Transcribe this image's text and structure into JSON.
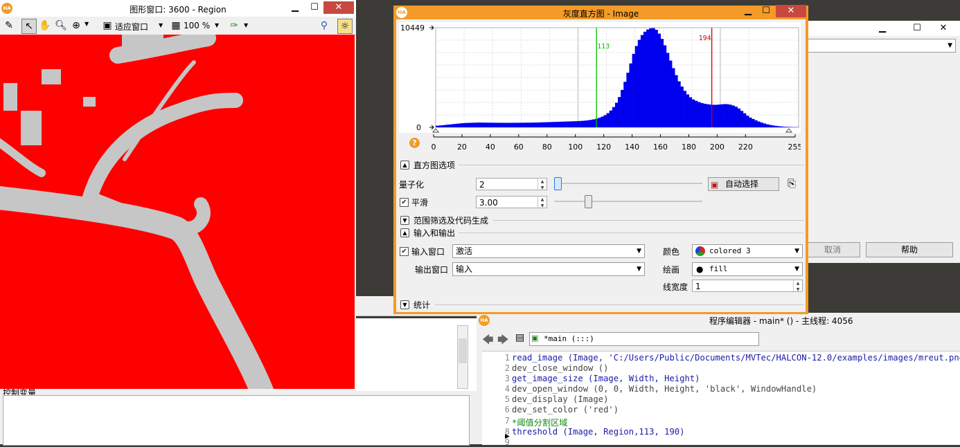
{
  "graphics_window": {
    "title": "图形窗口: 3600 - Region",
    "logo": "HA",
    "zoom_mode": "适应窗口",
    "zoom_percent": "100 %",
    "toolbar_icons": [
      "pencil-icon",
      "pointer-icon",
      "hand-icon",
      "magnifier-icon",
      "zoom-in-icon",
      "fit-window-icon",
      "zoom-percent-icon",
      "color-picker-icon",
      "pixel-info-icon",
      "light-icon"
    ],
    "region_color": "#ff0000",
    "image_color": "#c8c8c8"
  },
  "histogram": {
    "title": "灰度直方图 - Image",
    "logo": "HA",
    "help_icon": "?",
    "y_max_label": "10449",
    "y_min_label": "0",
    "min_threshold": "113",
    "max_threshold": "194",
    "min_color": "#00c000",
    "max_color": "#d00000",
    "bar_color": "#0000ee",
    "options_section": "直方图选项",
    "quantize_label": "量子化",
    "quantize_value": "2",
    "auto_select_label": "自动选择",
    "smooth_label": "平滑",
    "smooth_checked": true,
    "smooth_value": "3.00",
    "range_section": "范围筛选及代码生成",
    "io_section": "输入和输出",
    "input_window_label": "输入窗口",
    "input_window_value": "激活",
    "output_window_label": "输出窗口",
    "output_window_value": "输入",
    "color_label": "颜色",
    "color_value": "colored 3",
    "draw_label": "绘画",
    "draw_value": "fill",
    "line_width_label": "线宽度",
    "line_width_value": "1",
    "stats_section": "统计"
  },
  "chart_data": {
    "type": "area",
    "title": "",
    "xlabel": "",
    "ylabel": "",
    "xlim": [
      0,
      255
    ],
    "ylim": [
      0,
      10449
    ],
    "x_ticks": [
      "0",
      "20",
      "40",
      "60",
      "80",
      "100",
      "120",
      "140",
      "160",
      "180",
      "200",
      "220",
      "255"
    ],
    "grid": true,
    "series": [
      {
        "x": [
          0,
          10,
          20,
          30,
          40,
          50,
          60,
          70,
          80,
          90,
          100,
          105,
          110,
          113,
          116,
          120,
          124,
          128,
          132,
          136,
          140,
          144,
          148,
          152,
          154,
          156,
          160,
          164,
          168,
          172,
          176,
          180,
          184,
          188,
          192,
          196,
          200,
          204,
          208,
          212,
          216,
          220,
          224,
          228,
          232,
          236,
          240,
          245,
          250,
          255
        ],
        "values": [
          150,
          300,
          450,
          500,
          480,
          470,
          480,
          500,
          550,
          600,
          650,
          700,
          800,
          900,
          1050,
          1350,
          1900,
          2800,
          4300,
          6200,
          8200,
          9500,
          10200,
          10449,
          10350,
          10100,
          9000,
          7400,
          5800,
          4500,
          3600,
          3000,
          2700,
          2500,
          2400,
          2350,
          2400,
          2450,
          2350,
          2100,
          1600,
          1100,
          800,
          550,
          350,
          220,
          130,
          60,
          30,
          10
        ]
      }
    ]
  },
  "behind_window": {
    "cancel_label": "取消",
    "help_label": "帮助"
  },
  "bottom_left": {
    "header_label": "控制变量"
  },
  "program_editor": {
    "logo": "HA",
    "title": "程序编辑器 - main* () - 主线程: 4056",
    "procedure_label": "*main (:::)",
    "lines": [
      {
        "n": "1",
        "text": "read_image (Image, 'C:/Users/Public/Documents/MVTec/HALCON-12.0/examples/images/mreut.png')",
        "kind": "proc"
      },
      {
        "n": "2",
        "text": "dev_close_window ()",
        "kind": "ctl"
      },
      {
        "n": "3",
        "text": "get_image_size (Image, Width, Height)",
        "kind": "proc"
      },
      {
        "n": "4",
        "text": "dev_open_window (0, 0, Width, Height, 'black', WindowHandle)",
        "kind": "ctl"
      },
      {
        "n": "5",
        "text": "dev_display (Image)",
        "kind": "ctl"
      },
      {
        "n": "6",
        "text": "dev_set_color ('red')",
        "kind": "ctl"
      },
      {
        "n": "7",
        "text": "*阈值分割区域",
        "kind": "cmt"
      },
      {
        "n": "8",
        "text": "threshold (Image, Region,113, 190)",
        "kind": "proc"
      },
      {
        "n": "9",
        "text": "",
        "kind": "ctl"
      }
    ]
  }
}
